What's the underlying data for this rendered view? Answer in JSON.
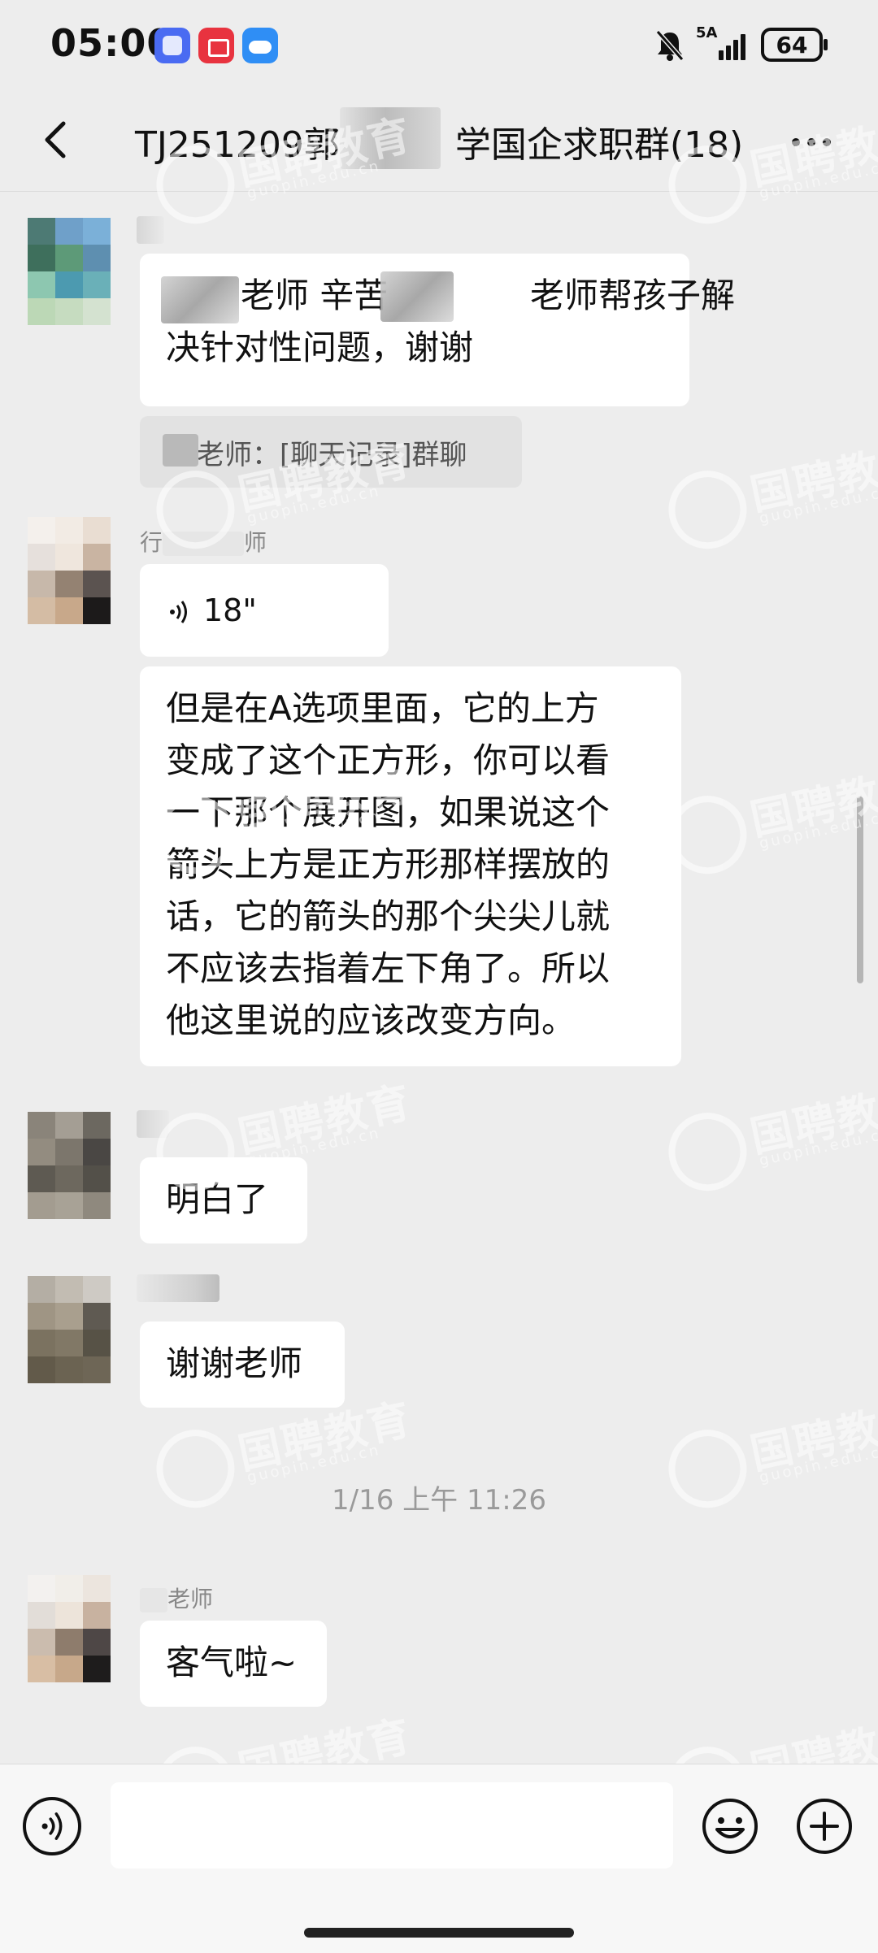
{
  "status_bar": {
    "time": "05:00",
    "network_label": "5A",
    "battery": "64",
    "icons": [
      "tieba-icon",
      "app-gallery-icon",
      "weather-icon",
      "bell-off-icon",
      "signal-icon",
      "battery-icon"
    ]
  },
  "header": {
    "title_prefix": "TJ251209郭",
    "title_suffix": "学国企求职群(18)",
    "back_icon": "chevron-left-icon",
    "more_icon": "more-icon"
  },
  "messages": [
    {
      "id": "m1",
      "sender": "",
      "lines": [
        "老师 辛苦",
        "老师帮孩子解",
        "决针对性问题，谢谢"
      ]
    },
    {
      "id": "m1q",
      "quote": "老师：[聊天记录]群聊"
    },
    {
      "id": "m2",
      "sender_start": "行",
      "sender_end": "师",
      "voice_duration": "18\""
    },
    {
      "id": "m3",
      "lines": [
        "但是在A选项里面，它的上方",
        "变成了这个正方形，你可以看",
        "一下那个展开图，如果说这个",
        "箭头上方是正方形那样摆放的",
        "话，它的箭头的那个尖尖儿就",
        "不应该去指着左下角了。所以",
        "他这里说的应该改变方向。"
      ]
    },
    {
      "id": "m4",
      "text": "明白了"
    },
    {
      "id": "m5",
      "text": "谢谢老师"
    },
    {
      "id": "m6",
      "sender_end": "老师",
      "text": "客气啦~"
    }
  ],
  "timestamp": "1/16 上午 11:26",
  "watermark": {
    "text": "国聘教育",
    "sub": "guopin.edu.cn"
  },
  "input": {
    "placeholder": "",
    "value": ""
  },
  "colors": {
    "background": "#ededed",
    "bubble": "#ffffff",
    "accent": "#111111"
  }
}
